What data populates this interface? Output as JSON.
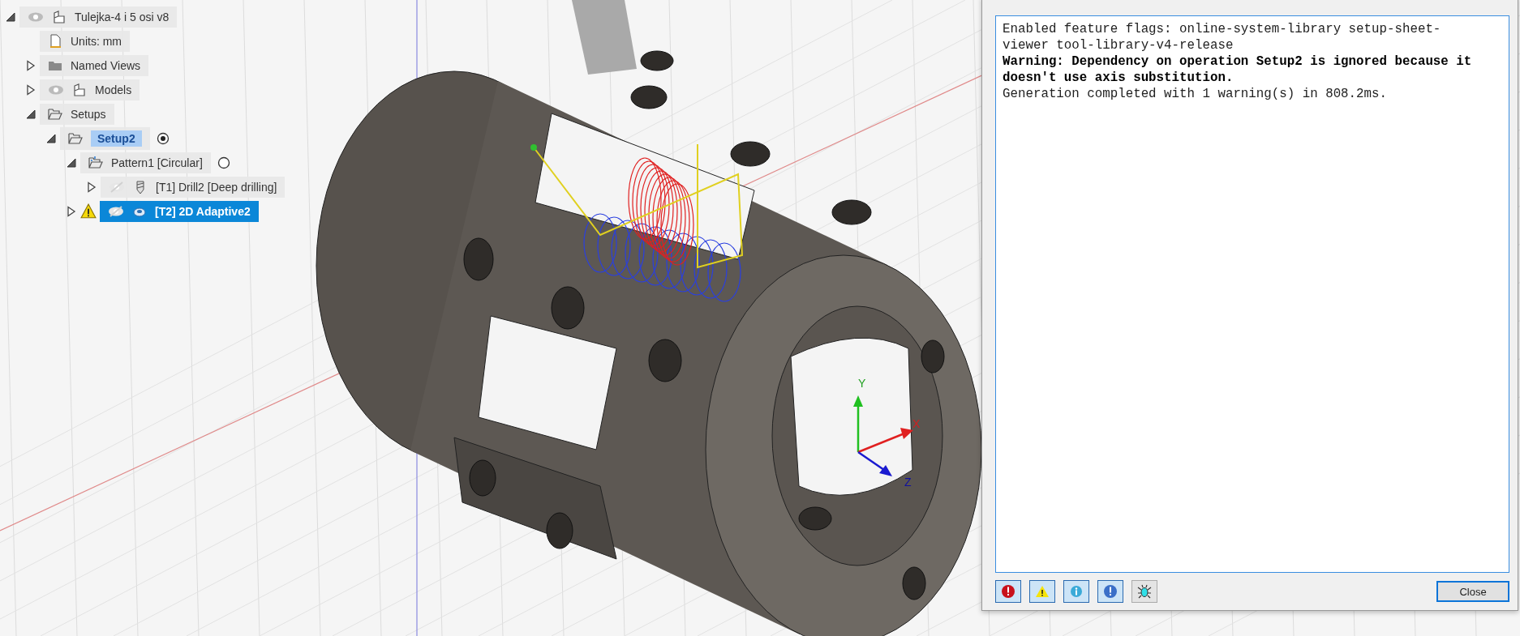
{
  "browser_tree": [
    {
      "label": "Tulejka-4 i 5 osi v8",
      "kind": "component",
      "expanded": true,
      "visible": true,
      "selected": false,
      "children": [
        {
          "label": "Units: mm",
          "kind": "units",
          "selected": false
        },
        {
          "label": "Named Views",
          "kind": "folder",
          "expanded": false,
          "selected": false
        },
        {
          "label": "Models",
          "kind": "component",
          "expanded": false,
          "visible": true,
          "selected": false
        },
        {
          "label": "Setups",
          "kind": "setups",
          "expanded": true,
          "selected": false,
          "children": [
            {
              "label": "Setup2",
              "kind": "setup",
              "expanded": true,
              "active": true,
              "selected": false,
              "children": [
                {
                  "label": "Pattern1 [Circular]",
                  "kind": "pattern",
                  "expanded": true,
                  "active": false,
                  "selected": false,
                  "children": [
                    {
                      "label": "[T1] Drill2 [Deep drilling]",
                      "kind": "drill",
                      "expanded": false,
                      "visible": false,
                      "selected": false
                    }
                  ]
                },
                {
                  "label": "[T2] 2D Adaptive2",
                  "kind": "adaptive",
                  "expanded": false,
                  "visible": false,
                  "warning": true,
                  "selected": true
                }
              ]
            }
          ]
        }
      ]
    }
  ],
  "view_triad": {
    "labels": [
      "Y",
      "X",
      "Z"
    ]
  },
  "log_dialog": {
    "lines": [
      {
        "kind": "info",
        "text": "Enabled feature flags: online-system-library setup-sheet-viewer tool-library-v4-release"
      },
      {
        "kind": "warning",
        "text": "Warning: Dependency on operation Setup2 is ignored because it doesn't use axis substitution."
      },
      {
        "kind": "info",
        "text": "Generation completed with 1 warning(s) in 808.2ms."
      }
    ],
    "filters": [
      {
        "kind": "error",
        "on": true
      },
      {
        "kind": "warning",
        "on": true
      },
      {
        "kind": "info",
        "on": true
      },
      {
        "kind": "notice",
        "on": true
      },
      {
        "kind": "debug",
        "on": false
      }
    ],
    "close_button": "Close"
  }
}
